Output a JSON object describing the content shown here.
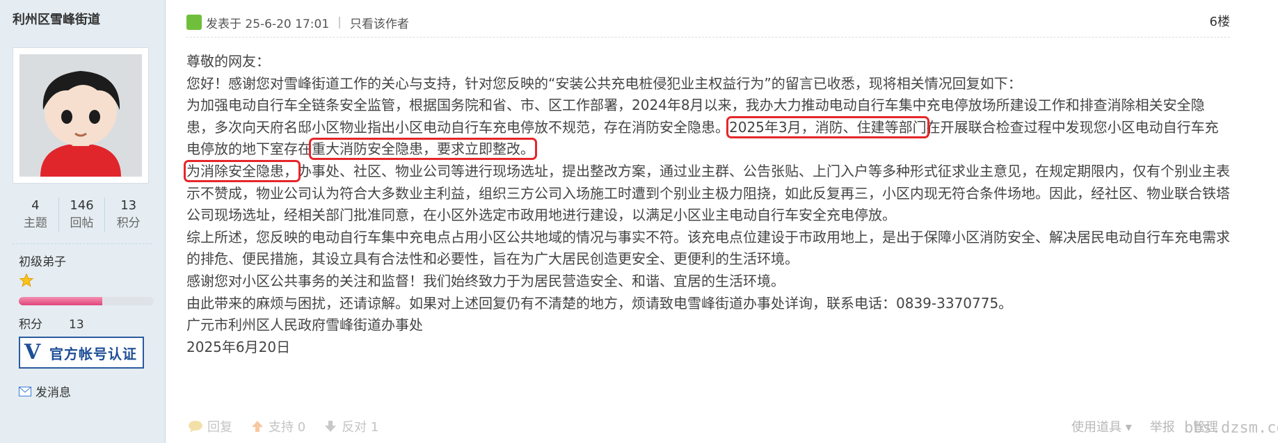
{
  "author": {
    "name": "利州区雪峰街道",
    "stats": [
      {
        "value": "4",
        "label": "主题"
      },
      {
        "value": "146",
        "label": "回帖"
      },
      {
        "value": "13",
        "label": "积分"
      }
    ],
    "rank": "初级弟子",
    "progress_fraction": 0.62,
    "points_label": "积分",
    "points_value": "13",
    "verified_label": "官方帐号认证",
    "verified_badge": "V",
    "pm_label": "发消息"
  },
  "post": {
    "posted_at": "发表于 25-6-20 17:01",
    "only_author": "只看该作者",
    "floor": "6楼",
    "p1": "尊敬的网友：",
    "p2": "您好！感谢您对雪峰街道工作的关心与支持，针对您反映的“安装公共充电桩侵犯业主权益行为”的留言已收悉，现将相关情况回复如下：",
    "p3a": "为加强电动自行车全链条安全监管，根据国务院和省、市、区工作部署，2024年8月以来，我办大力推动电动自行车集中充电停放场所建设工作和排查消除相关安全隐患，多次向天府名邸小区物业指出小区电动自行车充电停放不规范，存在消防安全隐患。",
    "p3b": "2025年3月，消防、住建等部门",
    "p3c": "在开展联合检查过程中发现您小区电动自行车充电停放的地下室存在",
    "p3d": "重大消防安全隐患，要求立即整改。",
    "p4a": "为消除安全隐患，",
    "p4b": "办事处、社区、物业公司等进行现场选址，提出整改方案，通过业主群、公告张贴、上门入户等多种形式征求业主意见，在规定期限内，仅有个别业主表示不赞成，物业公司认为符合大多数业主利益，组织三方公司入场施工时遭到个别业主极力阻挠，如此反复再三，小区内现无符合条件场地。因此，经社区、物业联合铁塔公司现场选址，经相关部门批准同意，在小区外选定市政用地进行建设，以满足小区业主电动自行车安全充电停放。",
    "p5": "综上所述，您反映的电动自行车集中充电点占用小区公共地域的情况与事实不符。该充电点位建设于市政用地上，是出于保障小区消防安全、解决居民电动自行车充电需求的排危、便民措施，其设立具有合法性和必要性，旨在为广大居民创造更安全、更便利的生活环境。",
    "p6": "感谢您对小区公共事务的关注和监督！我们始终致力于为居民营造安全、和谐、宜居的生活环境。",
    "p7": "由此带来的麻烦与困扰，还请谅解。如果对上述回复仍有不清楚的地方，烦请致电雪峰街道办事处详询，联系电话：0839-3370775。",
    "p8": "广元市利州区人民政府雪峰街道办事处",
    "p9": "2025年6月20日"
  },
  "actions": {
    "reply": "回复",
    "support": "支持 0",
    "oppose": "反对 1",
    "tools": "使用道具",
    "report": "举报",
    "manage": "管理"
  },
  "watermark": "bbs.dzsm.com",
  "colors": {
    "sidebar_bg": "#e5edf2",
    "highlight": "#e5262a",
    "verified": "#1f4f96"
  }
}
